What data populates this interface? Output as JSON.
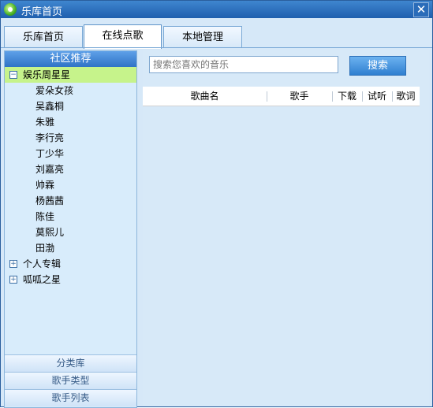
{
  "window": {
    "title": "乐库首页",
    "close_glyph": "✕"
  },
  "tabs": [
    {
      "label": "乐库首页",
      "active": false
    },
    {
      "label": "在线点歌",
      "active": true
    },
    {
      "label": "本地管理",
      "active": false
    }
  ],
  "sidebar": {
    "header": "社区推荐",
    "groups": [
      {
        "label": "娱乐周星星",
        "expanded": true,
        "expander": "−",
        "children": [
          "爱朵女孩",
          "吴鑫桐",
          "朱雅",
          "李行亮",
          "丁少华",
          "刘嘉亮",
          "帅霖",
          "杨茜茜",
          "陈佳",
          "莫熙儿",
          "田渤"
        ]
      },
      {
        "label": "个人专辑",
        "expanded": false,
        "expander": "+"
      },
      {
        "label": "呱呱之星",
        "expanded": false,
        "expander": "+"
      }
    ],
    "bottom_buttons": [
      "分类库",
      "歌手类型",
      "歌手列表"
    ]
  },
  "search": {
    "placeholder": "搜索您喜欢的音乐",
    "button": "搜索"
  },
  "table": {
    "columns": [
      "歌曲名",
      "歌手",
      "下载",
      "试听",
      "歌词"
    ]
  },
  "colors": {
    "selected_row": "#c6f38b",
    "titlebar": "#1f5fae",
    "accent_blue": "#2f7fd0"
  }
}
